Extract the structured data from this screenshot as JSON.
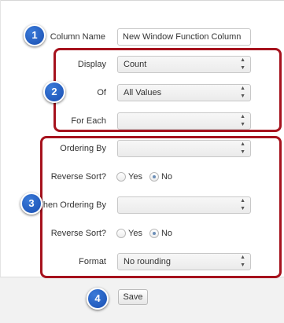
{
  "form": {
    "column_name": {
      "label": "Column Name",
      "value": "New Window Function Column"
    },
    "display": {
      "label": "Display",
      "selected": "Count"
    },
    "of": {
      "label": "Of",
      "selected": "All Values"
    },
    "for_each": {
      "label": "For Each",
      "selected": ""
    },
    "ordering_by": {
      "label": "Ordering By",
      "selected": ""
    },
    "reverse_sort_1": {
      "label": "Reverse Sort?",
      "yes": "Yes",
      "no": "No",
      "selected": "No"
    },
    "then_ordering_by": {
      "label": "Then Ordering By",
      "selected": ""
    },
    "reverse_sort_2": {
      "label": "Reverse Sort?",
      "yes": "Yes",
      "no": "No",
      "selected": "No"
    },
    "format": {
      "label": "Format",
      "selected": "No rounding"
    }
  },
  "footer": {
    "save_label": "Save"
  },
  "callouts": [
    "1",
    "2",
    "3",
    "4"
  ],
  "colors": {
    "callout": "#2160c4",
    "highlight": "#a6121d",
    "footer_bg": "#f2f2f2"
  }
}
